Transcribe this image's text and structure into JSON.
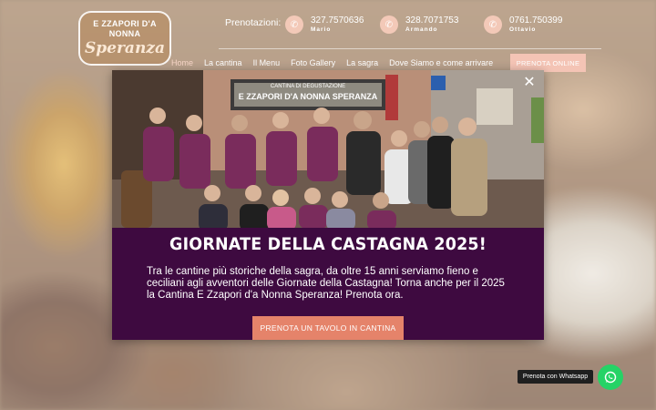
{
  "header": {
    "logo_line1": "E ZZAPORI D'A NONNA",
    "logo_line2": "Speranza",
    "prenotazioni_label": "Prenotazioni:",
    "contacts": [
      {
        "number": "327.7570636",
        "name": "Mario",
        "icon": "phone-icon"
      },
      {
        "number": "328.7071753",
        "name": "Armando",
        "icon": "phone-icon"
      },
      {
        "number": "0761.750399",
        "name": "Ottavio",
        "icon": "phone-icon"
      }
    ]
  },
  "nav": {
    "items": [
      "Home",
      "La cantina",
      "Il Menu",
      "Foto Gallery",
      "La sagra",
      "Dove Siamo e come arrivare"
    ],
    "active": "Home",
    "cta": "PRENOTA ONLINE"
  },
  "modal": {
    "sign_small": "CANTINA DI DEGUSTAZIONE",
    "sign_text": "E ZZAPORI D'A NONNA SPERANZA",
    "title": "GIORNATE DELLA CASTAGNA 2025!",
    "body": "Tra le cantine più storiche della sagra, da oltre 15 anni serviamo fieno e ceciliani agli avventori delle Giornate della Castagna! Torna anche per il 2025 la Cantina E Zzapori d'a Nonna Speranza! Prenota ora.",
    "button": "PRENOTA UN TAVOLO IN CANTINA",
    "close_icon": "close-icon"
  },
  "whatsapp": {
    "label": "Prenota con Whatsapp",
    "icon": "whatsapp-icon"
  },
  "colors": {
    "modal_bg": "#3e0a40",
    "button": "#e5836a",
    "whatsapp": "#25d366"
  }
}
